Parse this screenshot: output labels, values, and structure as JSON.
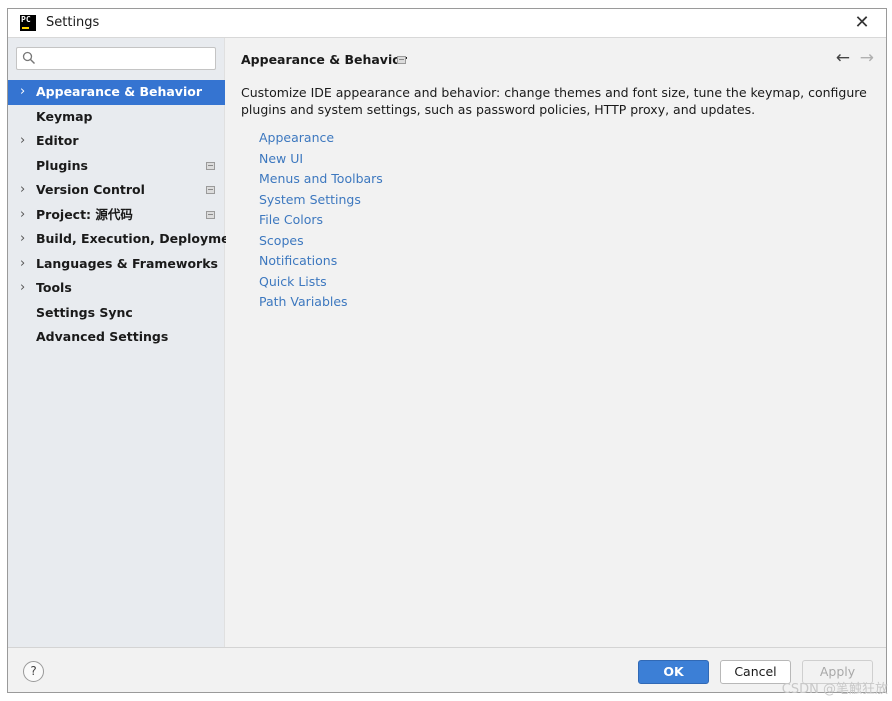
{
  "window": {
    "title": "Settings",
    "app_icon": "PC",
    "close_glyph": "✕"
  },
  "search": {
    "value": "",
    "placeholder": ""
  },
  "sidebar": {
    "items": [
      {
        "label": "Appearance & Behavior",
        "chevron": true,
        "badge": false,
        "selected": true
      },
      {
        "label": "Keymap",
        "chevron": false,
        "badge": false,
        "selected": false
      },
      {
        "label": "Editor",
        "chevron": true,
        "badge": false,
        "selected": false
      },
      {
        "label": "Plugins",
        "chevron": false,
        "badge": true,
        "selected": false
      },
      {
        "label": "Version Control",
        "chevron": true,
        "badge": true,
        "selected": false
      },
      {
        "label": "Project: 源代码",
        "chevron": true,
        "badge": true,
        "selected": false
      },
      {
        "label": "Build, Execution, Deployment",
        "chevron": true,
        "badge": false,
        "selected": false
      },
      {
        "label": "Languages & Frameworks",
        "chevron": true,
        "badge": false,
        "selected": false
      },
      {
        "label": "Tools",
        "chevron": true,
        "badge": false,
        "selected": false
      },
      {
        "label": "Settings Sync",
        "chevron": false,
        "badge": false,
        "selected": false
      },
      {
        "label": "Advanced Settings",
        "chevron": false,
        "badge": false,
        "selected": false
      }
    ]
  },
  "content": {
    "heading": "Appearance & Behavior",
    "back_glyph": "←",
    "forward_glyph": "→",
    "description": "Customize IDE appearance and behavior: change themes and font size, tune the keymap, configure plugins and system settings, such as password policies, HTTP proxy, and updates.",
    "links": [
      "Appearance",
      "New UI",
      "Menus and Toolbars",
      "System Settings",
      "File Colors",
      "Scopes",
      "Notifications",
      "Quick Lists",
      "Path Variables"
    ]
  },
  "footer": {
    "help_label": "?",
    "ok_label": "OK",
    "cancel_label": "Cancel",
    "apply_label": "Apply"
  },
  "watermark": "CSDN @笔触狂放",
  "colors": {
    "selection": "#3574d1",
    "link": "#3d78bf",
    "ok_button": "#3c7fd6",
    "sidebar_bg": "#e8ebef",
    "content_bg": "#f2f2f2"
  }
}
